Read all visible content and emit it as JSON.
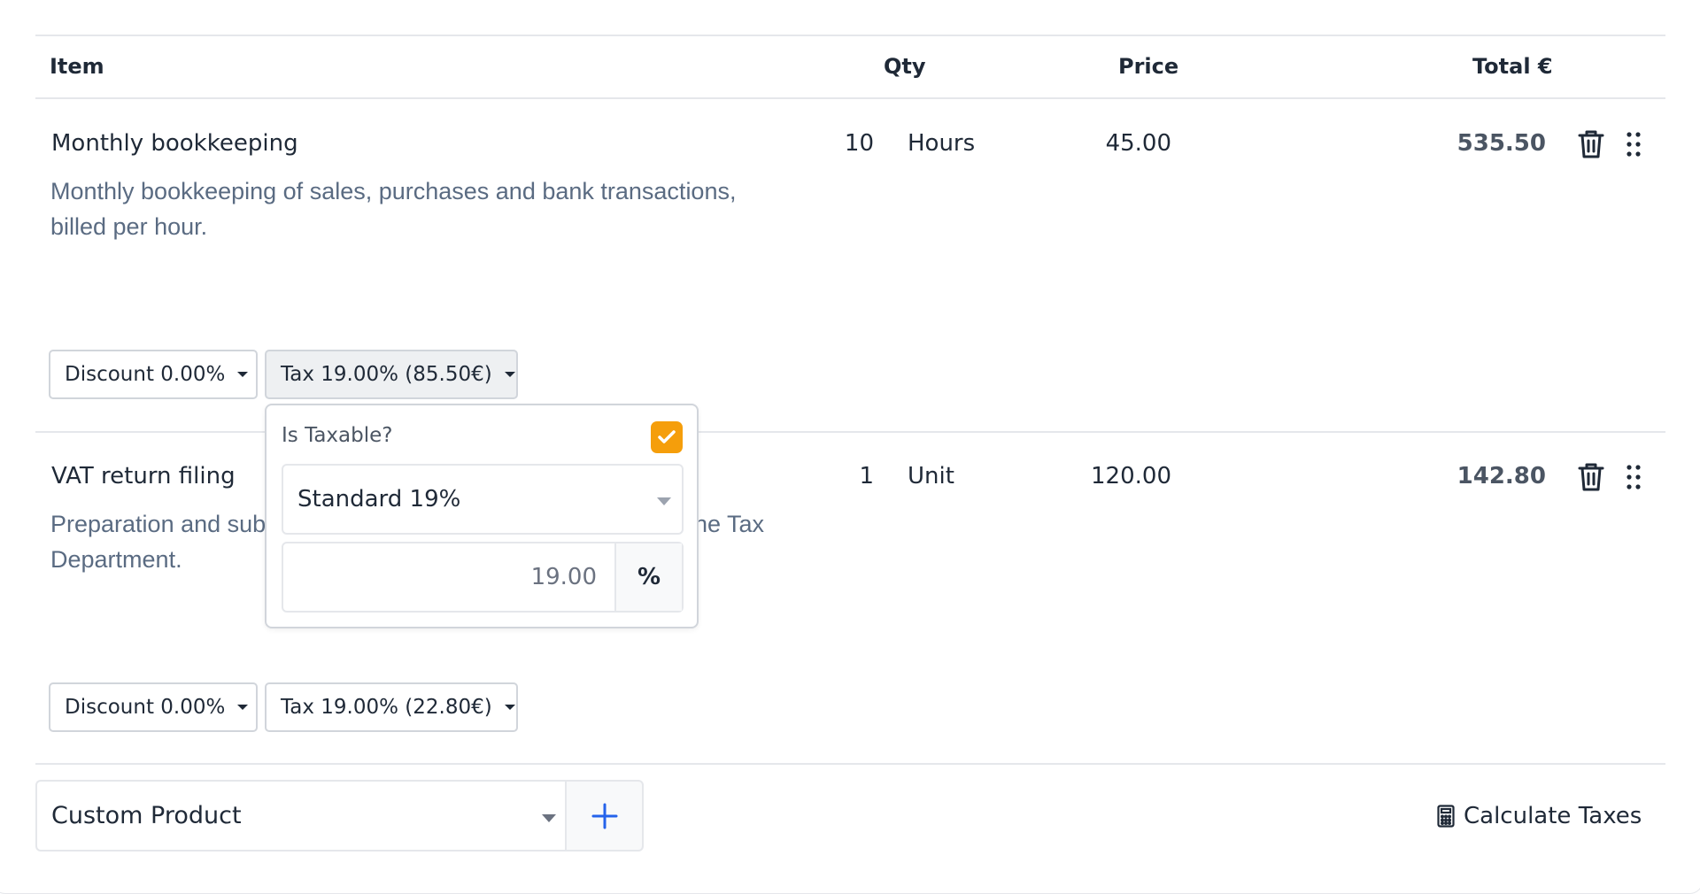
{
  "table": {
    "headers": {
      "item": "Item",
      "qty": "Qty",
      "price": "Price",
      "total": "Total €"
    }
  },
  "lines": [
    {
      "title": "Monthly bookkeeping",
      "description": "Monthly bookkeeping of sales, purchases and bank transactions, billed per hour.",
      "qty": "10",
      "unit": "Hours",
      "price": "45.00",
      "total": "535.50",
      "discount_label": "Discount 0.00%",
      "tax_label": "Tax 19.00% (85.50€)"
    },
    {
      "title": "VAT return filing",
      "description_visible_start": "Preparation and sub",
      "description_visible_end": "he Tax",
      "description_line2": "Department.",
      "qty": "1",
      "unit": "Unit",
      "price": "120.00",
      "total": "142.80",
      "discount_label": "Discount 0.00%",
      "tax_label": "Tax 19.00% (22.80€)"
    }
  ],
  "tax_popover": {
    "taxable_label": "Is Taxable?",
    "taxable_checked": true,
    "rate_select_value": "Standard 19%",
    "rate_value": "19.00",
    "rate_unit": "%"
  },
  "footer": {
    "product_select_value": "Custom Product",
    "add_icon": "plus-icon",
    "calculate_label": "Calculate Taxes"
  },
  "colors": {
    "accent_orange": "#f59e0b",
    "accent_blue": "#2563eb",
    "text_muted": "#5a6b82",
    "border": "#e5e7eb"
  }
}
